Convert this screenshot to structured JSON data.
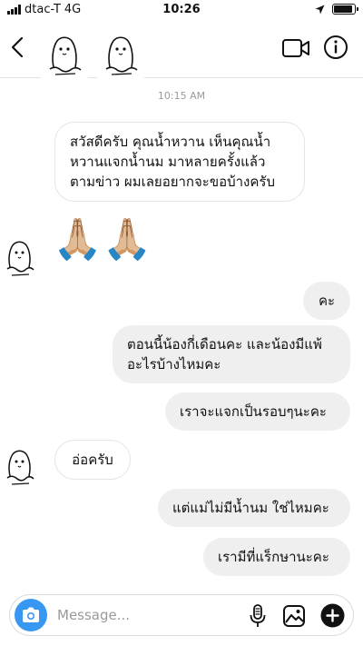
{
  "status_bar": {
    "carrier": "dtac-T",
    "network": "4G",
    "time": "10:26",
    "battery_level": 0.92
  },
  "header": {
    "participants": [
      "ghost-avatar",
      "ghost-avatar"
    ],
    "icons": {
      "back": "chevron-left-icon",
      "video": "video-camera-icon",
      "info": "info-icon"
    }
  },
  "thread": {
    "timestamp": "10:15 AM",
    "messages": [
      {
        "side": "incoming",
        "text": "สวัสดีครับ คุณน้ำหวาน เห็นคุณน้ำ\nหวานแจกน้ำนม มาหลายครั้งแล้ว\nตามข่าว ผมเลยอยากจะขอบ้างครับ"
      },
      {
        "side": "incoming",
        "text": "🙏🏼🙏🏼"
      },
      {
        "side": "outgoing",
        "text": "คะ"
      },
      {
        "side": "outgoing",
        "text": "ตอนนี้น้องกี่เดือนคะ และน้องมีแพ้\nอะไรบ้างไหมคะ"
      },
      {
        "side": "outgoing",
        "text": "เราจะแจกเป็นรอบๆนะคะ"
      },
      {
        "side": "incoming",
        "text": "อ่อครับ"
      },
      {
        "side": "outgoing",
        "text": "แต่แม่ไม่มีน้ำนม ใช่ไหมคะ"
      },
      {
        "side": "outgoing",
        "text": "เรามีที่แร็กษานะคะ"
      }
    ]
  },
  "composer": {
    "placeholder": "Message...",
    "icons": {
      "camera": "camera-icon",
      "mic": "microphone-icon",
      "gallery": "gallery-icon",
      "plus": "plus-icon"
    },
    "accent_color": "#3897f0"
  }
}
